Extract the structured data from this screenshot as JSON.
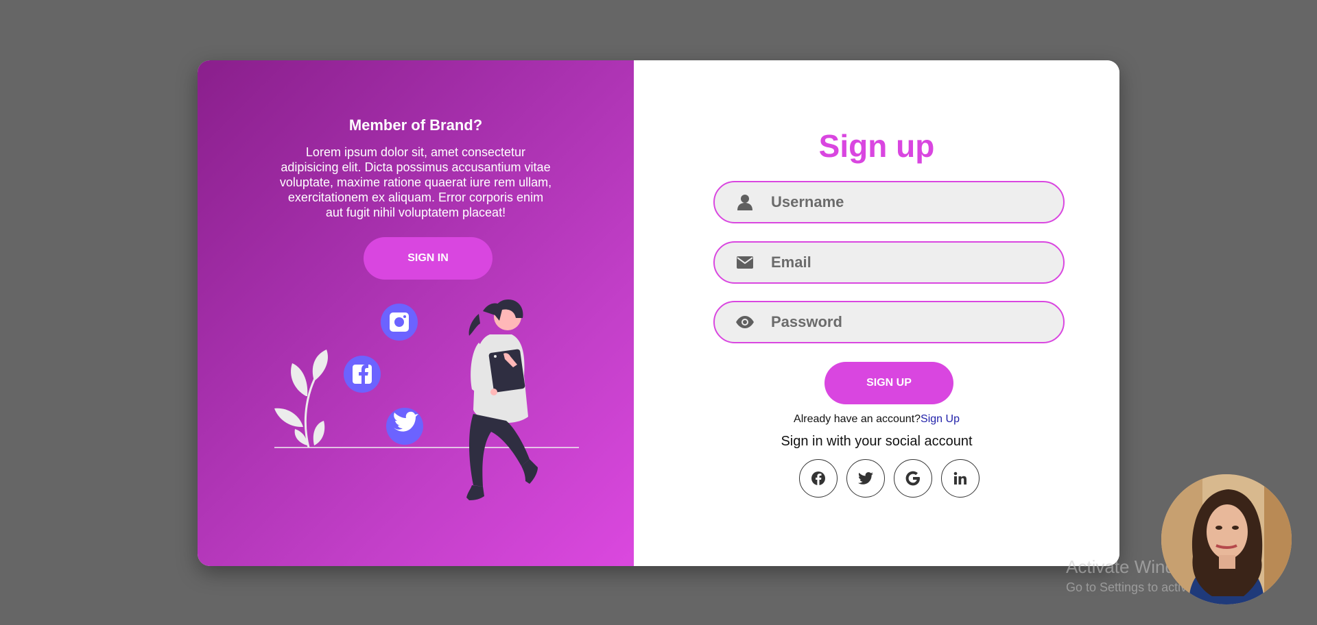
{
  "left_panel": {
    "title": "Member of Brand?",
    "description": "Lorem ipsum dolor sit, amet consectetur adipisicing elit. Dicta possimus accusantium vitae voluptate, maxime ratione quaerat iure rem ullam, exercitationem ex aliquam. Error corporis enim aut fugit nihil voluptatem placeat!",
    "sign_in_label": "SIGN IN",
    "illustration_icons": [
      "instagram-icon",
      "facebook-icon",
      "twitter-icon"
    ],
    "gradient_colors": [
      "#8a1f8c",
      "#db48df"
    ]
  },
  "form": {
    "title": "Sign up",
    "username_placeholder": "Username",
    "email_placeholder": "Email",
    "password_placeholder": "Password",
    "username_icon": "user-icon",
    "email_icon": "envelope-icon",
    "password_icon": "eye-icon",
    "submit_label": "SIGN UP",
    "already_text": "Already have an account?",
    "already_link": "Sign Up",
    "social_heading": "Sign in with your social account",
    "social_icons": [
      "facebook-icon",
      "twitter-icon",
      "google-icon",
      "linkedin-icon"
    ],
    "accent_color": "#d946e0"
  },
  "overlay": {
    "watermark_title": "Activate Windows",
    "watermark_subtitle": "Go to Settings to activate Windows."
  }
}
